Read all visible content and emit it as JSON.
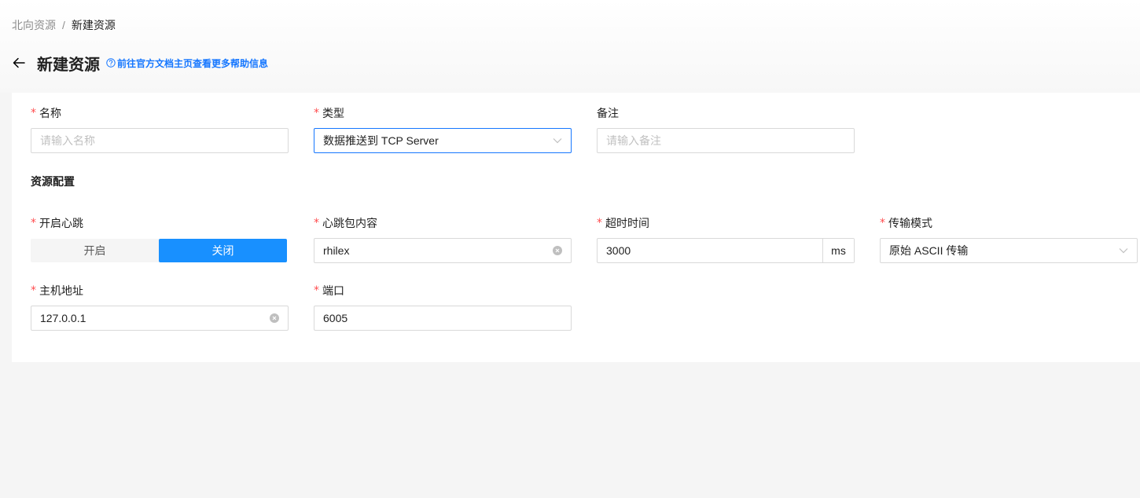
{
  "breadcrumb": {
    "parent": "北向资源",
    "separator": "/",
    "current": "新建资源"
  },
  "header": {
    "title": "新建资源",
    "help_link": "前往官方文档主页查看更多帮助信息"
  },
  "form": {
    "name": {
      "label": "名称",
      "placeholder": "请输入名称",
      "required": "*"
    },
    "type": {
      "label": "类型",
      "value": "数据推送到 TCP Server",
      "required": "*"
    },
    "remark": {
      "label": "备注",
      "placeholder": "请输入备注"
    },
    "section_title": "资源配置",
    "heartbeat": {
      "label": "开启心跳",
      "required": "*",
      "options": [
        "开启",
        "关闭"
      ],
      "selected": "关闭"
    },
    "heartbeat_content": {
      "label": "心跳包内容",
      "value": "rhilex",
      "required": "*"
    },
    "timeout": {
      "label": "超时时间",
      "value": "3000",
      "unit": "ms",
      "required": "*"
    },
    "transfer_mode": {
      "label": "传输模式",
      "value": "原始 ASCII 传输",
      "required": "*"
    },
    "host": {
      "label": "主机地址",
      "value": "127.0.0.1",
      "required": "*"
    },
    "port": {
      "label": "端口",
      "value": "6005",
      "required": "*"
    }
  },
  "colors": {
    "primary": "#1677ff",
    "segment_active": "#1890ff",
    "required": "#ff4d4f"
  }
}
